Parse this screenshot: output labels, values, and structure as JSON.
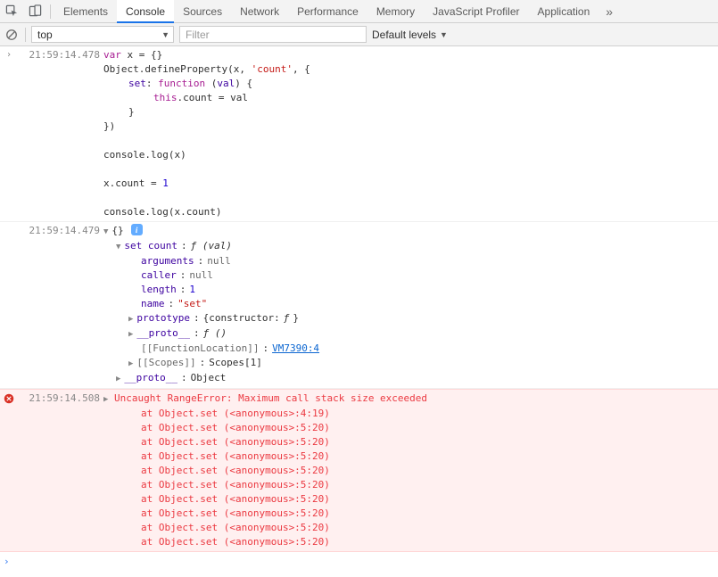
{
  "tabs": {
    "items": [
      "Elements",
      "Console",
      "Sources",
      "Network",
      "Performance",
      "Memory",
      "JavaScript Profiler",
      "Application"
    ],
    "activeIndex": 1,
    "overflow": "»"
  },
  "filterbar": {
    "context": "top",
    "filterPlaceholder": "Filter",
    "levels": "Default levels"
  },
  "entry_code": {
    "ts": "21:59:14.478",
    "lines": {
      "l0a": "var",
      "l0b": " x = {}",
      "blank": "",
      "l1a": "Object.defineProperty(x, ",
      "l1b": "'count'",
      "l1c": ", {",
      "l2a": "set",
      "l2b": ": ",
      "l2c": "function",
      "l2d": " (",
      "l2e": "val",
      "l2f": ") {",
      "l3a": "this",
      "l3b": ".count = val",
      "l4": "}",
      "l5": "})",
      "l6": "console.log(x)",
      "l7a": "x.count = ",
      "l7b": "1",
      "l8": "console.log(x.count)"
    }
  },
  "entry_obj": {
    "ts": "21:59:14.479",
    "head": "{}",
    "badge": "i",
    "p_set_k": "set count",
    "p_set_sep": ": ",
    "p_set_v": "ƒ (val)",
    "p_args_k": "arguments",
    "p_args_sep": ": ",
    "p_args_v": "null",
    "p_caller_k": "caller",
    "p_caller_sep": ": ",
    "p_caller_v": "null",
    "p_len_k": "length",
    "p_len_sep": ": ",
    "p_len_v": "1",
    "p_name_k": "name",
    "p_name_sep": ": ",
    "p_name_v": "\"set\"",
    "p_proto_k": "prototype",
    "p_proto_sep": ": ",
    "p_proto_v1": "{constructor: ",
    "p_proto_v2": "ƒ",
    "p_proto_v3": "}",
    "p_pp_k": "__proto__",
    "p_pp_sep": ": ",
    "p_pp_v": "ƒ ()",
    "p_fl_k": "[[FunctionLocation]]",
    "p_fl_sep": ": ",
    "p_fl_v": "VM7390:4",
    "p_sc_k": "[[Scopes]]",
    "p_sc_sep": ": ",
    "p_sc_v": "Scopes[1]",
    "p_pp2_k": "__proto__",
    "p_pp2_sep": ": ",
    "p_pp2_v": "Object"
  },
  "entry_err": {
    "ts": "21:59:14.508",
    "head": "Uncaught RangeError: Maximum call stack size exceeded",
    "stack": [
      "at Object.set (<anonymous>:4:19)",
      "at Object.set (<anonymous>:5:20)",
      "at Object.set (<anonymous>:5:20)",
      "at Object.set (<anonymous>:5:20)",
      "at Object.set (<anonymous>:5:20)",
      "at Object.set (<anonymous>:5:20)",
      "at Object.set (<anonymous>:5:20)",
      "at Object.set (<anonymous>:5:20)",
      "at Object.set (<anonymous>:5:20)",
      "at Object.set (<anonymous>:5:20)"
    ]
  }
}
